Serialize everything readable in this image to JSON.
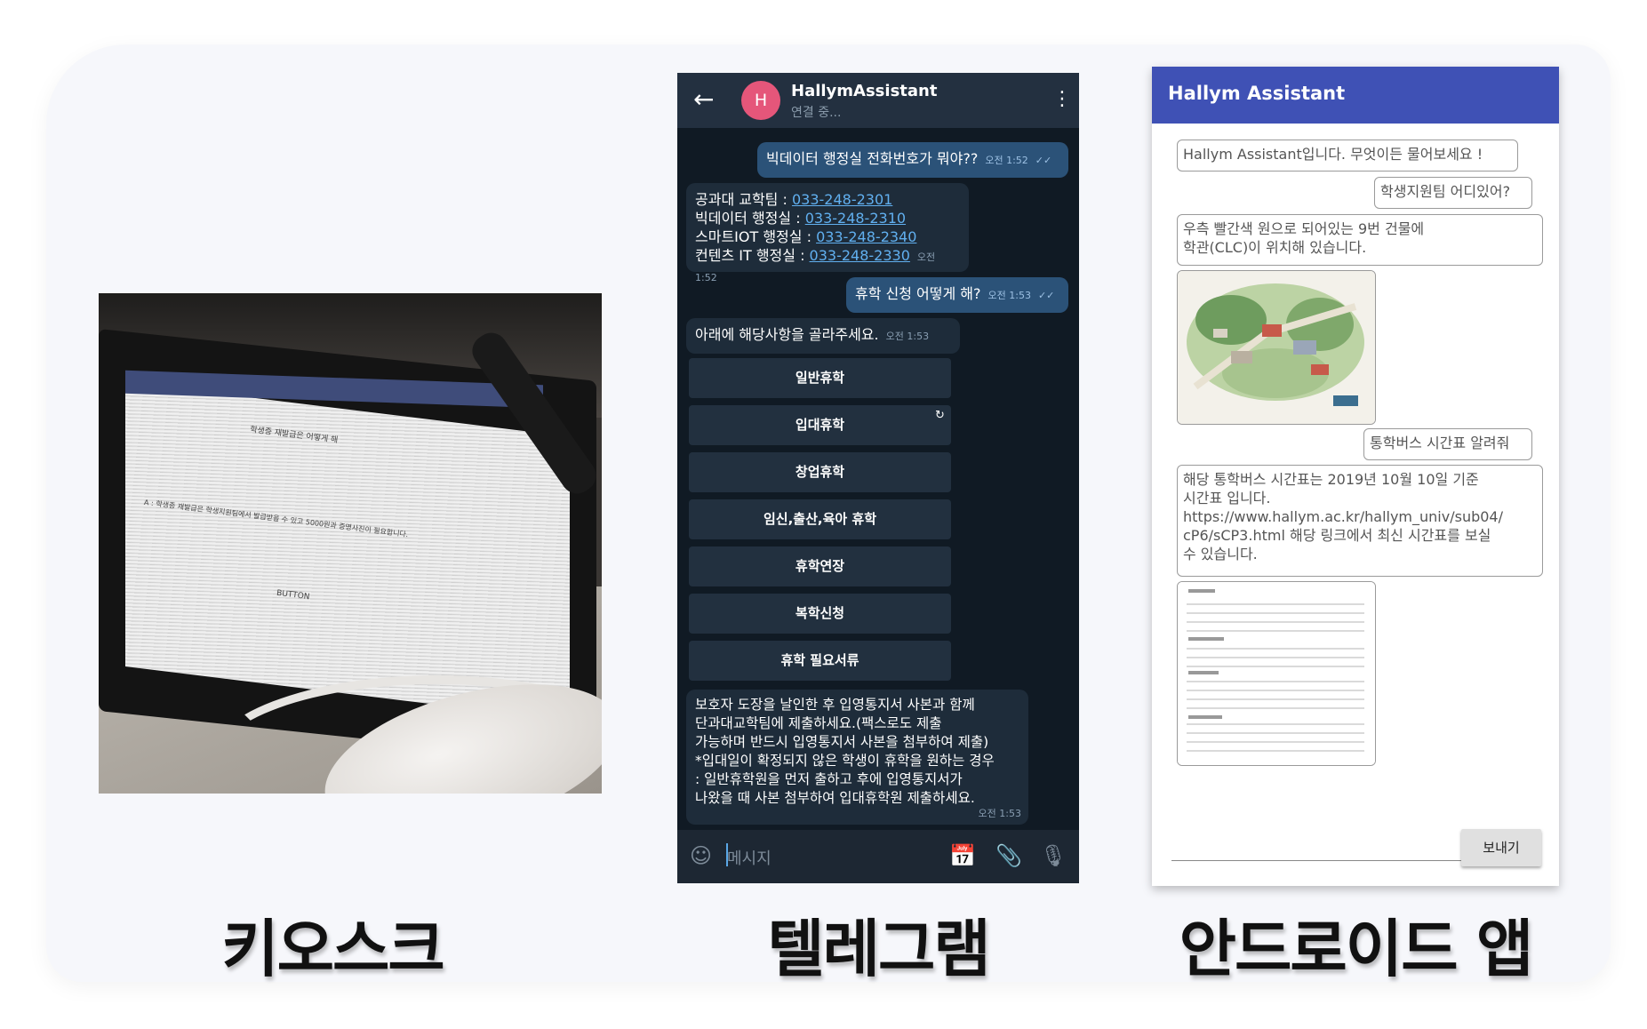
{
  "labels": {
    "kiosk": "키오스크",
    "telegram": "텔레그램",
    "android": "안드로이드 앱"
  },
  "kiosk_photo": {
    "screen_texts": [
      "학생증 재발급은 어떻게 해",
      "A : 학생증 재발급은 학생지원팀에서 발급받을 수 있고 5000원과 증명사진이 필요합니다.",
      "BUTTON"
    ]
  },
  "telegram": {
    "avatar_letter": "H",
    "name": "HallymAssistant",
    "status": "연결 중...",
    "messages": [
      {
        "text": "빅데이터 행정실 전화번호가 뭐야??",
        "time": "오전 1:52"
      },
      {
        "lines": [
          {
            "label": "공과대 교학팀 : ",
            "phone": "033-248-2301"
          },
          {
            "label": "빅데이터 행정실 : ",
            "phone": "033-248-2310"
          },
          {
            "label": "스마트IOT 행정실 : ",
            "phone": "033-248-2340"
          },
          {
            "label": "컨텐츠 IT 행정실 : ",
            "phone": "033-248-2330"
          }
        ],
        "time": "오전 1:52"
      },
      {
        "text": "휴학 신청 어떻게 해?",
        "time": "오전 1:53"
      },
      {
        "text": "아래에 해당사항을 골라주세요.",
        "time": "오전 1:53"
      },
      {
        "text": "보호자 도장을 날인한 후 입영통지서 사본과 함께\n단과대교학팀에 제출하세요.(팩스로도 제출\n가능하며 반드시 입영통지서 사본을 첨부하여 제출)\n*입대일이 확정되지 않은 학생이 휴학을 원하는 경우\n: 일반휴학원을 먼저 출하고 후에 입영통지서가\n나왔을 때 사본 첨부하여 입대휴학원 제출하세요.",
        "time": "오전 1:53"
      }
    ],
    "buttons": [
      "일반휴학",
      "입대휴학",
      "창업휴학",
      "임신,출산,육아 휴학",
      "휴학연장",
      "복학신청",
      "휴학 필요서류"
    ],
    "input_placeholder": "메시지"
  },
  "android": {
    "title": "Hallym Assistant",
    "messages": [
      {
        "text": "Hallym Assistant입니다. 무엇이든 물어보세요 !"
      },
      {
        "text": "학생지원팀 어디있어?"
      },
      {
        "text": "우측 빨간색 원으로 되어있는 9번 건물에\n학관(CLC)이 위치해 있습니다."
      },
      {
        "text": "통학버스 시간표 알려줘"
      },
      {
        "text": "해당 통학버스 시간표는 2019년 10월 10일 기준\n시간표 입니다.\nhttps://www.hallym.ac.kr/hallym_univ/sub04/\ncP6/sCP3.html 해당 링크에서 최신 시간표를 보실\n수 있습니다."
      }
    ],
    "send_label": "보내기"
  },
  "colors": {
    "telegram_bg": "#101a24",
    "telegram_out": "#2b5278",
    "telegram_in": "#1e2c3a",
    "android_header": "#3f51b5",
    "avatar": "#e5567a"
  }
}
